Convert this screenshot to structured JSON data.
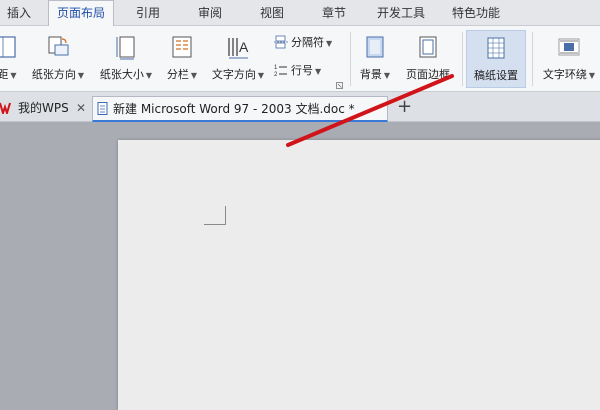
{
  "menu": {
    "tabs": [
      {
        "label": "插入"
      },
      {
        "label": "页面布局"
      },
      {
        "label": "引用"
      },
      {
        "label": "审阅"
      },
      {
        "label": "视图"
      },
      {
        "label": "章节"
      },
      {
        "label": "开发工具"
      },
      {
        "label": "特色功能"
      }
    ],
    "active_index": 1
  },
  "ribbon": {
    "margins_label": "距",
    "orientation_label": "纸张方向",
    "size_label": "纸张大小",
    "columns_label": "分栏",
    "text_direction_label": "文字方向",
    "separator_label": "分隔符",
    "line_number_label": "行号",
    "background_label": "背景",
    "page_border_label": "页面边框",
    "manuscript_label": "稿纸设置",
    "text_wrap_label": "文字环绕"
  },
  "doc_tabs": {
    "home_label": "我的WPS",
    "active_doc_label": "新建 Microsoft Word 97 - 2003 文档.doc *"
  },
  "colors": {
    "accent": "#2050a8",
    "annotation_arrow": "#d0141a",
    "highlight": "#d4e0f0"
  }
}
